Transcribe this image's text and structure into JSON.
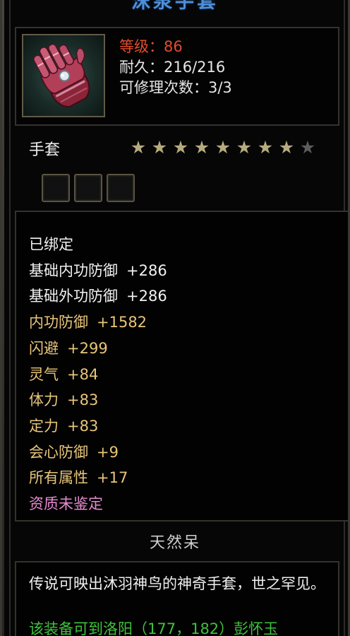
{
  "item": {
    "name": "沫泉手套",
    "level_label": "等级：86",
    "durability_label": "耐久：216/216",
    "repair_label": "可修理次数：3/3",
    "type": "手套",
    "stars_filled": 8,
    "stars_total": 9,
    "sockets_count": 3,
    "icon": "gauntlet-icon"
  },
  "attributes": [
    {
      "label": "已绑定",
      "value": "",
      "color": "white"
    },
    {
      "label": "基础内功防御",
      "value": "+286",
      "color": "white"
    },
    {
      "label": "基础外功防御",
      "value": "+286",
      "color": "white"
    },
    {
      "label": "内功防御",
      "value": "+1582",
      "color": "gold"
    },
    {
      "label": "闪避",
      "value": "+299",
      "color": "gold"
    },
    {
      "label": "灵气",
      "value": "+84",
      "color": "gold"
    },
    {
      "label": "体力",
      "value": "+83",
      "color": "gold"
    },
    {
      "label": "定力",
      "value": "+83",
      "color": "gold"
    },
    {
      "label": "会心防御",
      "value": "+9",
      "color": "gold"
    },
    {
      "label": "所有属性",
      "value": "+17",
      "color": "gold"
    },
    {
      "label": "资质未鉴定",
      "value": "",
      "color": "pink"
    }
  ],
  "quality": "天然呆",
  "description": {
    "text": "传说可映出沐羽神鸟的神奇手套，世之罕见。",
    "hint": "该装备可到洛阳（177，182）彭怀玉"
  },
  "colors": {
    "title": "#4f8fd8",
    "level": "#e24c2c",
    "gold_attr": "#e8c57a",
    "pink_attr": "#e58ad0",
    "hint": "#3ec23c"
  }
}
